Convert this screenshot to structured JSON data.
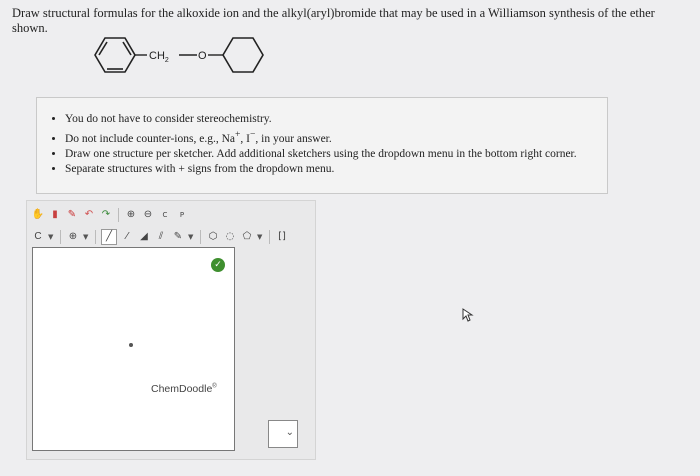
{
  "question": {
    "text": "Draw structural formulas for the alkoxide ion and the alkyl(aryl)bromide that may be used in a Williamson synthesis of the ether shown."
  },
  "molecule": {
    "linker_ch2": "CH",
    "linker_ch2_sub": "2",
    "linker_o": "O"
  },
  "instructions": {
    "items": [
      "You do not have to consider stereochemistry.",
      "Do not include counter-ions, e.g., Na",
      "Draw one structure per sketcher. Add additional sketchers using the dropdown menu in the bottom right corner.",
      "Separate structures with + signs from the dropdown menu."
    ],
    "item2_sup1": "+",
    "item2_mid": ", I",
    "item2_sup2": "−",
    "item2_end": ", in your answer."
  },
  "sketcher": {
    "brand": "ChemDoodle",
    "brand_mark": "®",
    "atom_selector": "C",
    "toolbar_row1": [
      "hand-icon",
      "eraser-icon",
      "pencil-icon",
      "undo-icon",
      "redo-icon",
      "zoom-in-icon",
      "zoom-out-icon",
      "c-sty-icon",
      "p-info-icon"
    ],
    "toolbar_row2": [
      "atom-selector",
      "charge-icon",
      "single-bond-icon",
      "double-bond-icon",
      "wedge-bond-icon",
      "hash-bond-icon",
      "ring-hexagon-icon",
      "ring-pentagon-icon",
      "ring-cyclopentane-icon",
      "bracket-icon"
    ]
  },
  "add_sketcher": {
    "value": ""
  }
}
